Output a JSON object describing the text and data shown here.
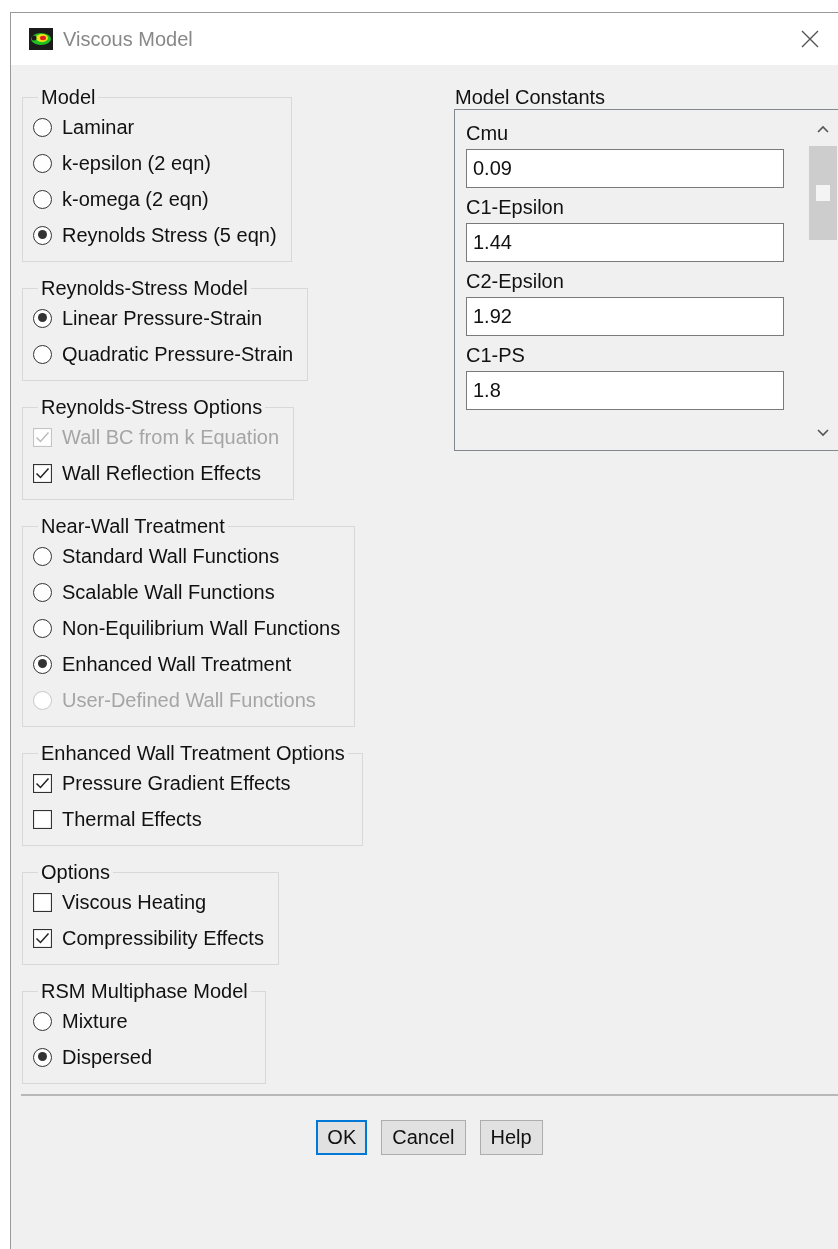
{
  "window": {
    "title": "Viscous Model"
  },
  "groups": [
    {
      "title": "Model",
      "kind": "radio",
      "items": [
        {
          "label": "Laminar",
          "selected": false,
          "disabled": false
        },
        {
          "label": "k-epsilon (2 eqn)",
          "selected": false,
          "disabled": false
        },
        {
          "label": "k-omega (2 eqn)",
          "selected": false,
          "disabled": false
        },
        {
          "label": "Reynolds Stress (5 eqn)",
          "selected": true,
          "disabled": false
        }
      ]
    },
    {
      "title": "Reynolds-Stress Model",
      "kind": "radio",
      "items": [
        {
          "label": "Linear Pressure-Strain",
          "selected": true,
          "disabled": false
        },
        {
          "label": "Quadratic Pressure-Strain",
          "selected": false,
          "disabled": false
        }
      ]
    },
    {
      "title": "Reynolds-Stress Options",
      "kind": "check",
      "items": [
        {
          "label": "Wall BC from k Equation",
          "checked": true,
          "disabled": true
        },
        {
          "label": "Wall Reflection Effects",
          "checked": true,
          "disabled": false
        }
      ]
    },
    {
      "title": "Near-Wall Treatment",
      "kind": "radio",
      "items": [
        {
          "label": "Standard Wall Functions",
          "selected": false,
          "disabled": false
        },
        {
          "label": "Scalable Wall Functions",
          "selected": false,
          "disabled": false
        },
        {
          "label": "Non-Equilibrium Wall Functions",
          "selected": false,
          "disabled": false
        },
        {
          "label": "Enhanced Wall Treatment",
          "selected": true,
          "disabled": false
        },
        {
          "label": "User-Defined Wall Functions",
          "selected": false,
          "disabled": true
        }
      ]
    },
    {
      "title": "Enhanced Wall Treatment Options",
      "kind": "check",
      "items": [
        {
          "label": "Pressure Gradient Effects",
          "checked": true,
          "disabled": false
        },
        {
          "label": "Thermal Effects",
          "checked": false,
          "disabled": false
        }
      ]
    },
    {
      "title": "Options",
      "kind": "check",
      "items": [
        {
          "label": "Viscous Heating",
          "checked": false,
          "disabled": false
        },
        {
          "label": "Compressibility Effects",
          "checked": true,
          "disabled": false
        }
      ]
    },
    {
      "title": "RSM Multiphase Model",
      "kind": "radio",
      "items": [
        {
          "label": "Mixture",
          "selected": false,
          "disabled": false
        },
        {
          "label": "Dispersed",
          "selected": true,
          "disabled": false
        }
      ]
    }
  ],
  "model_constants": {
    "title": "Model Constants",
    "items": [
      {
        "label": "Cmu",
        "value": "0.09"
      },
      {
        "label": "C1-Epsilon",
        "value": "1.44"
      },
      {
        "label": "C2-Epsilon",
        "value": "1.92"
      },
      {
        "label": "C1-PS",
        "value": "1.8"
      }
    ]
  },
  "buttons": [
    {
      "label": "OK",
      "default": true
    },
    {
      "label": "Cancel",
      "default": false
    },
    {
      "label": "Help",
      "default": false
    }
  ]
}
